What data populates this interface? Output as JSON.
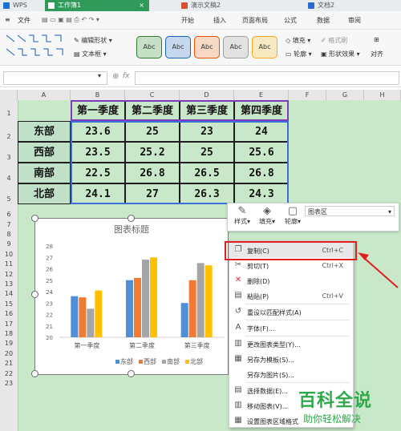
{
  "titlebar": {
    "tabs": [
      {
        "label": "WPS",
        "color": "#1a6fd6"
      },
      {
        "label": "工作簿1",
        "color": "#2f9a59",
        "active": true
      },
      {
        "label": "演示文稿2",
        "color": "#d6512e"
      },
      {
        "label": "文档2",
        "color": "#2a6bd1"
      }
    ]
  },
  "menubar": {
    "file": "文件",
    "items": [
      "开始",
      "插入",
      "页面布局",
      "公式",
      "数据",
      "审阅"
    ]
  },
  "ribbon": {
    "edit_shape": "编辑形状",
    "textbox": "文本框",
    "style_label": "Abc",
    "fill": "填充",
    "format_brush": "格式刷",
    "outline": "轮廓",
    "shape_effect": "形状效果",
    "align": "对齐",
    "style_colors": [
      "#2e7d32",
      "#1565c0",
      "#e65100",
      "#9e9e9e",
      "#f9a825"
    ]
  },
  "formula_bar": {
    "fx": "fx",
    "zoom_icon": "magnifier"
  },
  "sheet": {
    "columns": [
      "A",
      "B",
      "C",
      "D",
      "E",
      "F",
      "G",
      "H"
    ],
    "rows": [
      "1",
      "2",
      "3",
      "4",
      "5",
      "6",
      "7",
      "8",
      "9",
      "10",
      "11",
      "12",
      "13",
      "14",
      "15",
      "16",
      "17",
      "18",
      "19",
      "20",
      "21",
      "22",
      "23"
    ],
    "headers": [
      "第一季度",
      "第二季度",
      "第三季度",
      "第四季度"
    ],
    "table": [
      {
        "label": "东部",
        "values": [
          "23.6",
          "25",
          "23",
          "24"
        ]
      },
      {
        "label": "西部",
        "values": [
          "23.5",
          "25.2",
          "25",
          "25.6"
        ]
      },
      {
        "label": "南部",
        "values": [
          "22.5",
          "26.8",
          "26.5",
          "26.8"
        ]
      },
      {
        "label": "北部",
        "values": [
          "24.1",
          "27",
          "26.3",
          "24.3"
        ]
      }
    ]
  },
  "chart_data": {
    "type": "bar",
    "title": "图表标题",
    "categories": [
      "第一季度",
      "第二季度",
      "第三季度"
    ],
    "ylim": [
      20,
      28
    ],
    "yticks": [
      "20",
      "21",
      "22",
      "23",
      "24",
      "25",
      "26",
      "27",
      "28"
    ],
    "series": [
      {
        "name": "东部",
        "color": "#4e8fd6",
        "values": [
          23.6,
          25,
          23
        ]
      },
      {
        "name": "西部",
        "color": "#f07b34",
        "values": [
          23.5,
          25.2,
          25
        ]
      },
      {
        "name": "南部",
        "color": "#a5a5a5",
        "values": [
          22.5,
          26.8,
          26.5
        ]
      },
      {
        "name": "北部",
        "color": "#ffc000",
        "values": [
          24.1,
          27,
          26.3
        ]
      }
    ],
    "grid": false,
    "legend": "bottom"
  },
  "floatbar": {
    "style": "样式",
    "fill": "填充",
    "outline": "轮廓",
    "dropdown": "图表区"
  },
  "context_menu": {
    "items": [
      {
        "icon": "copy-icon",
        "glyph": "❐",
        "label": "复制(C)",
        "key": "Ctrl+C"
      },
      {
        "icon": "cut-icon",
        "glyph": "✂",
        "label": "剪切(T)",
        "key": "Ctrl+X"
      },
      {
        "icon": "delete-icon",
        "glyph": "✕",
        "label": "删除(D)",
        "key": ""
      },
      {
        "icon": "paste-icon",
        "glyph": "▤",
        "label": "粘贴(P)",
        "key": "Ctrl+V"
      },
      {
        "icon": "reset-style-icon",
        "glyph": "↺",
        "label": "重设以匹配样式(A)",
        "key": ""
      },
      {
        "icon": "font-icon",
        "glyph": "A",
        "label": "字体(F)...",
        "key": ""
      },
      {
        "icon": "chart-type-icon",
        "glyph": "▥",
        "label": "更改图表类型(Y)...",
        "key": ""
      },
      {
        "icon": "save-template-icon",
        "glyph": "▦",
        "label": "另存为模板(S)...",
        "key": ""
      },
      {
        "icon": "",
        "glyph": "",
        "label": "另存为图片(S)...",
        "key": ""
      },
      {
        "icon": "select-data-icon",
        "glyph": "▤",
        "label": "选择数据(E)...",
        "key": ""
      },
      {
        "icon": "move-chart-icon",
        "glyph": "▥",
        "label": "移动图表(V)...",
        "key": ""
      },
      {
        "icon": "format-chart-icon",
        "glyph": "▦",
        "label": "设置图表区域格式",
        "key": ""
      }
    ]
  },
  "watermark": {
    "title": "百科全说",
    "subtitle": "助你轻松解决"
  }
}
